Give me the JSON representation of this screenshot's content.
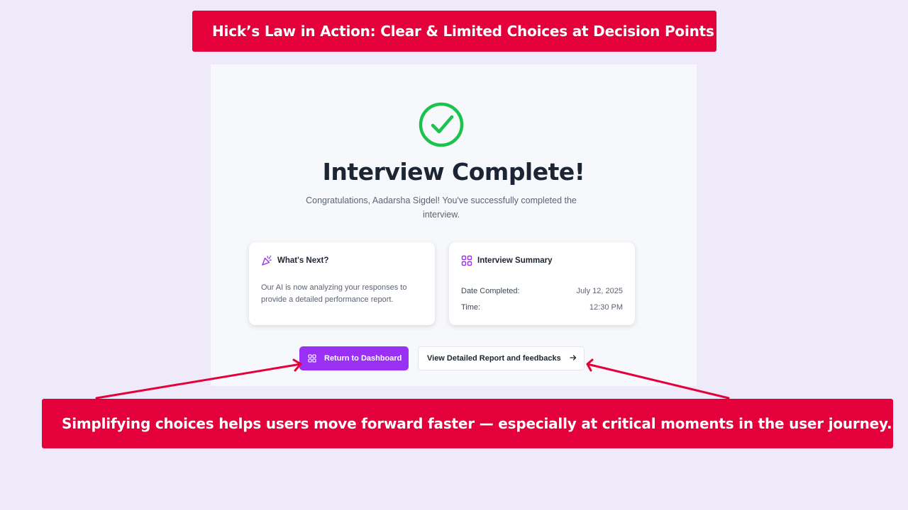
{
  "top_banner": {
    "text": "Hick’s Law in Action: Clear & Limited Choices at Decision Points"
  },
  "bottom_banner": {
    "text": "Simplifying choices helps users move forward faster — especially at critical moments in the user journey."
  },
  "screen": {
    "title": "Interview Complete!",
    "subtitle": "Congratulations, Aadarsha Sigdel! You've successfully completed the interview.",
    "whats_next": {
      "icon": "party-popper-icon",
      "heading": "What's Next?",
      "body": "Our AI is now analyzing your responses to provide a detailed performance report."
    },
    "summary": {
      "icon": "grid-icon",
      "heading": "Interview Summary",
      "date_label": "Date Completed:",
      "date_value": "July 12, 2025",
      "time_label": "Time:",
      "time_value": "12:30 PM"
    },
    "primary_button": {
      "label": "Return to Dashboard",
      "icon": "grid-icon"
    },
    "secondary_button": {
      "label": "View Detailed Report and feedbacks",
      "icon": "arrow-right-icon"
    }
  },
  "colors": {
    "banner": "#E4003A",
    "background": "#EFEAFA",
    "success": "#1BC24D",
    "primary_button": "#9B30F5",
    "annotation_arrow": "#E4003A"
  }
}
